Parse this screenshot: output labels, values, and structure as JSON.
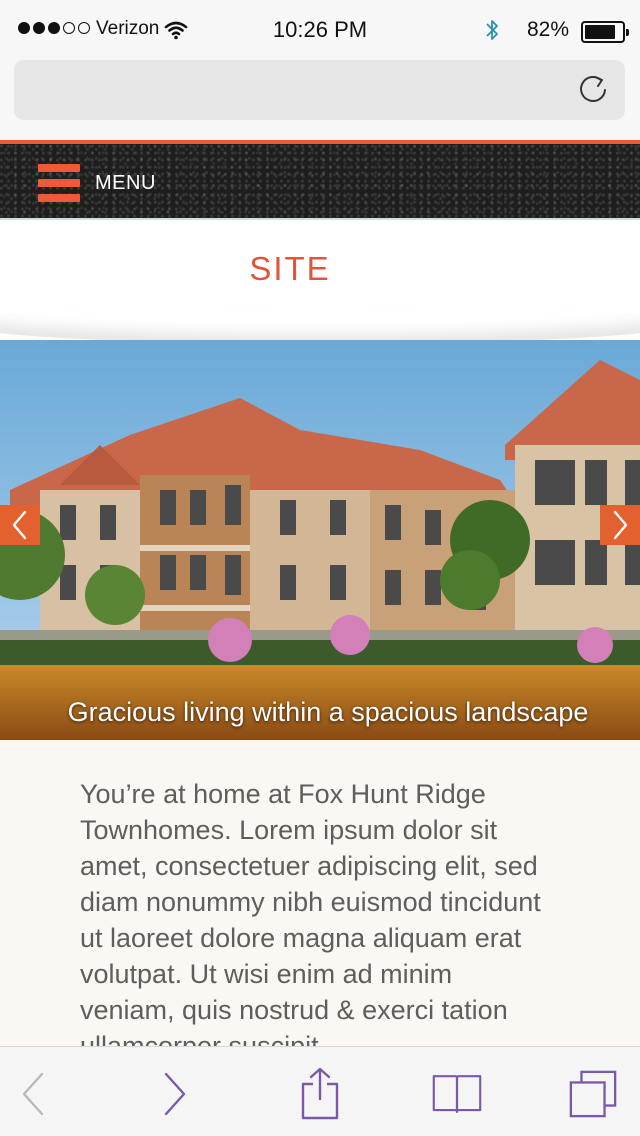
{
  "status_bar": {
    "carrier": "Verizon",
    "time": "10:26 PM",
    "battery_percent": "82%",
    "signal_strength": 3,
    "battery_level": 0.82
  },
  "menu": {
    "label": "MENU"
  },
  "site": {
    "title": "SITE"
  },
  "hero": {
    "caption": "Gracious living within a spacious landscape"
  },
  "content": {
    "intro": "You’re at home at Fox Hunt Ridge Townhomes. Lorem ipsum dolor sit amet, consectetuer adipiscing elit, sed diam nonummy nibh euismod tincidunt ut laoreet dolore magna aliquam erat volutpat. Ut wisi enim ad minim veniam, quis nostrud & exerci tation ullamcorper suscipit"
  },
  "icons": {
    "wifi": "wifi-icon",
    "bluetooth": "bluetooth-icon",
    "reload": "reload-icon",
    "menu": "hamburger-icon",
    "prev_slide": "chevron-left-icon",
    "next_slide": "chevron-right-icon",
    "back": "back-icon",
    "forward": "forward-icon",
    "share": "share-icon",
    "bookmarks": "bookmarks-icon",
    "tabs": "tabs-icon"
  },
  "colors": {
    "accent": "#e9593a",
    "site_title": "#e0553a",
    "toolbar_icon": "#7a5aa8",
    "toolbar_icon_disabled": "#b9b9b9"
  }
}
